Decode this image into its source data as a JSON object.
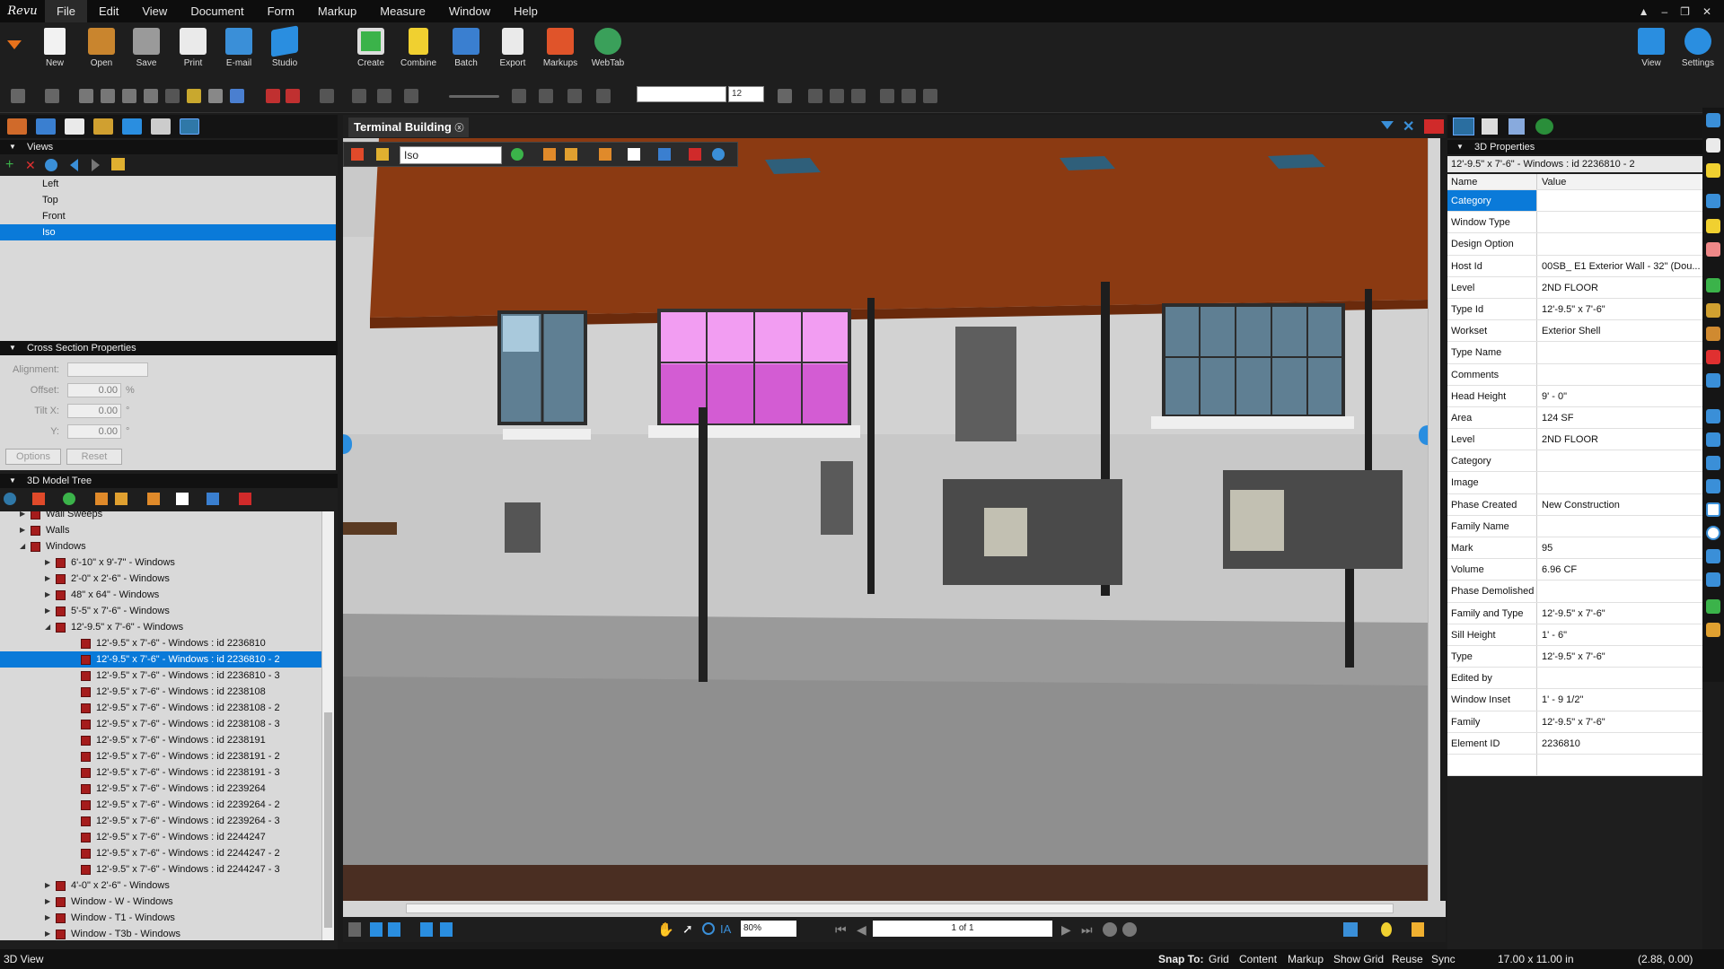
{
  "app": {
    "logo": "Revu"
  },
  "menu": [
    "File",
    "Edit",
    "View",
    "Document",
    "Form",
    "Markup",
    "Measure",
    "Window",
    "Help"
  ],
  "window_controls": [
    "▲",
    "–",
    "❐",
    "✕"
  ],
  "ribbon": {
    "left": [
      "New",
      "Open",
      "Save",
      "Print",
      "E-mail",
      "Studio"
    ],
    "middle": [
      "Create",
      "Combine",
      "Batch",
      "Export",
      "Markups",
      "WebTab"
    ],
    "right": [
      "View",
      "Settings"
    ]
  },
  "font_size": "12",
  "views": {
    "header": "Views",
    "items": [
      "Left",
      "Top",
      "Front",
      "Iso"
    ],
    "selected": "Iso"
  },
  "cross_section": {
    "header": "Cross Section Properties",
    "alignment_label": "Alignment:",
    "offset_label": "Offset:",
    "offset_value": "0.00",
    "offset_unit": "%",
    "tiltx_label": "Tilt X:",
    "tiltx_value": "0.00",
    "tiltx_unit": "°",
    "y_label": "Y:",
    "y_value": "0.00",
    "y_unit": "°",
    "options_button": "Options",
    "reset_button": "Reset"
  },
  "model_tree": {
    "header": "3D Model Tree",
    "rows": [
      {
        "level": 1,
        "label": "Wall Sweeps",
        "arrow": "▶"
      },
      {
        "level": 1,
        "label": "Walls",
        "arrow": "▶"
      },
      {
        "level": 1,
        "label": "Windows",
        "arrow": "◢"
      },
      {
        "level": 2,
        "label": "6'-10\" x 9'-7\" - Windows",
        "arrow": "▶"
      },
      {
        "level": 2,
        "label": "2'-0\" x 2'-6\" - Windows",
        "arrow": "▶"
      },
      {
        "level": 2,
        "label": "48\" x 64\" - Windows",
        "arrow": "▶"
      },
      {
        "level": 2,
        "label": "5'-5\" x 7'-6\" - Windows",
        "arrow": "▶"
      },
      {
        "level": 2,
        "label": "12'-9.5\" x 7'-6\" - Windows",
        "arrow": "◢"
      },
      {
        "level": 3,
        "label": "12'-9.5\" x 7'-6\" - Windows : id 2236810",
        "arrow": ""
      },
      {
        "level": 3,
        "label": "12'-9.5\" x 7'-6\" - Windows : id 2236810 - 2",
        "arrow": "",
        "selected": true
      },
      {
        "level": 3,
        "label": "12'-9.5\" x 7'-6\" - Windows : id 2236810 - 3",
        "arrow": ""
      },
      {
        "level": 3,
        "label": "12'-9.5\" x 7'-6\" - Windows : id 2238108",
        "arrow": ""
      },
      {
        "level": 3,
        "label": "12'-9.5\" x 7'-6\" - Windows : id 2238108 - 2",
        "arrow": ""
      },
      {
        "level": 3,
        "label": "12'-9.5\" x 7'-6\" - Windows : id 2238108 - 3",
        "arrow": ""
      },
      {
        "level": 3,
        "label": "12'-9.5\" x 7'-6\" - Windows : id 2238191",
        "arrow": ""
      },
      {
        "level": 3,
        "label": "12'-9.5\" x 7'-6\" - Windows : id 2238191 - 2",
        "arrow": ""
      },
      {
        "level": 3,
        "label": "12'-9.5\" x 7'-6\" - Windows : id 2238191 - 3",
        "arrow": ""
      },
      {
        "level": 3,
        "label": "12'-9.5\" x 7'-6\" - Windows : id 2239264",
        "arrow": ""
      },
      {
        "level": 3,
        "label": "12'-9.5\" x 7'-6\" - Windows : id 2239264 - 2",
        "arrow": ""
      },
      {
        "level": 3,
        "label": "12'-9.5\" x 7'-6\" - Windows : id 2239264 - 3",
        "arrow": ""
      },
      {
        "level": 3,
        "label": "12'-9.5\" x 7'-6\" - Windows : id 2244247",
        "arrow": ""
      },
      {
        "level": 3,
        "label": "12'-9.5\" x 7'-6\" - Windows : id 2244247 - 2",
        "arrow": ""
      },
      {
        "level": 3,
        "label": "12'-9.5\" x 7'-6\" - Windows : id 2244247 - 3",
        "arrow": ""
      },
      {
        "level": 2,
        "label": "4'-0\" x 2'-6\" - Windows",
        "arrow": "▶"
      },
      {
        "level": 2,
        "label": "Window - W - Windows",
        "arrow": "▶"
      },
      {
        "level": 2,
        "label": "Window - T1 - Windows",
        "arrow": "▶"
      },
      {
        "level": 2,
        "label": "Window - T3b - Windows",
        "arrow": "▶"
      }
    ]
  },
  "document": {
    "tab_title": "Terminal Building",
    "view_select": "Iso",
    "zoom": "80%",
    "page": "1 of 1"
  },
  "properties": {
    "header": "3D Properties",
    "title": "12'-9.5\" x 7'-6\" - Windows : id 2236810 - 2",
    "col_name": "Name",
    "col_value": "Value",
    "rows": [
      {
        "name": "Category",
        "value": "",
        "selected": true
      },
      {
        "name": "Window Type",
        "value": ""
      },
      {
        "name": "Design Option",
        "value": ""
      },
      {
        "name": "Host Id",
        "value": "00SB_ E1 Exterior Wall - 32\" (Dou..."
      },
      {
        "name": "Level",
        "value": "2ND FLOOR"
      },
      {
        "name": "Type Id",
        "value": "12'-9.5\" x 7'-6\""
      },
      {
        "name": "Workset",
        "value": "Exterior Shell"
      },
      {
        "name": "Type Name",
        "value": ""
      },
      {
        "name": "Comments",
        "value": ""
      },
      {
        "name": "Head Height",
        "value": "9' - 0\""
      },
      {
        "name": "Area",
        "value": "124 SF"
      },
      {
        "name": "Level",
        "value": "2ND FLOOR"
      },
      {
        "name": "Category",
        "value": ""
      },
      {
        "name": "Image",
        "value": ""
      },
      {
        "name": "Phase Created",
        "value": "New Construction"
      },
      {
        "name": "Family Name",
        "value": ""
      },
      {
        "name": "Mark",
        "value": "95"
      },
      {
        "name": "Volume",
        "value": "6.96 CF"
      },
      {
        "name": "Phase Demolished",
        "value": ""
      },
      {
        "name": "Family and Type",
        "value": "12'-9.5\" x 7'-6\""
      },
      {
        "name": "Sill Height",
        "value": "1' - 6\""
      },
      {
        "name": "Type",
        "value": "12'-9.5\" x 7'-6\""
      },
      {
        "name": "Edited by",
        "value": ""
      },
      {
        "name": "Window Inset",
        "value": "1' - 9 1/2\""
      },
      {
        "name": "Family",
        "value": "12'-9.5\" x 7'-6\""
      },
      {
        "name": "Element ID",
        "value": "2236810"
      },
      {
        "name": "",
        "value": ""
      }
    ]
  },
  "status": {
    "left": "3D View",
    "snap_label": "Snap To:",
    "toggles": [
      "Grid",
      "Content",
      "Markup",
      "Show Grid",
      "Reuse",
      "Sync"
    ],
    "page_size": "17.00 x 11.00 in",
    "coords": "(2.88, 0.00)"
  },
  "colors": {
    "accent": "#0a7ad9",
    "roof": "#8b3a12",
    "selected_window": "#d35cd3"
  }
}
